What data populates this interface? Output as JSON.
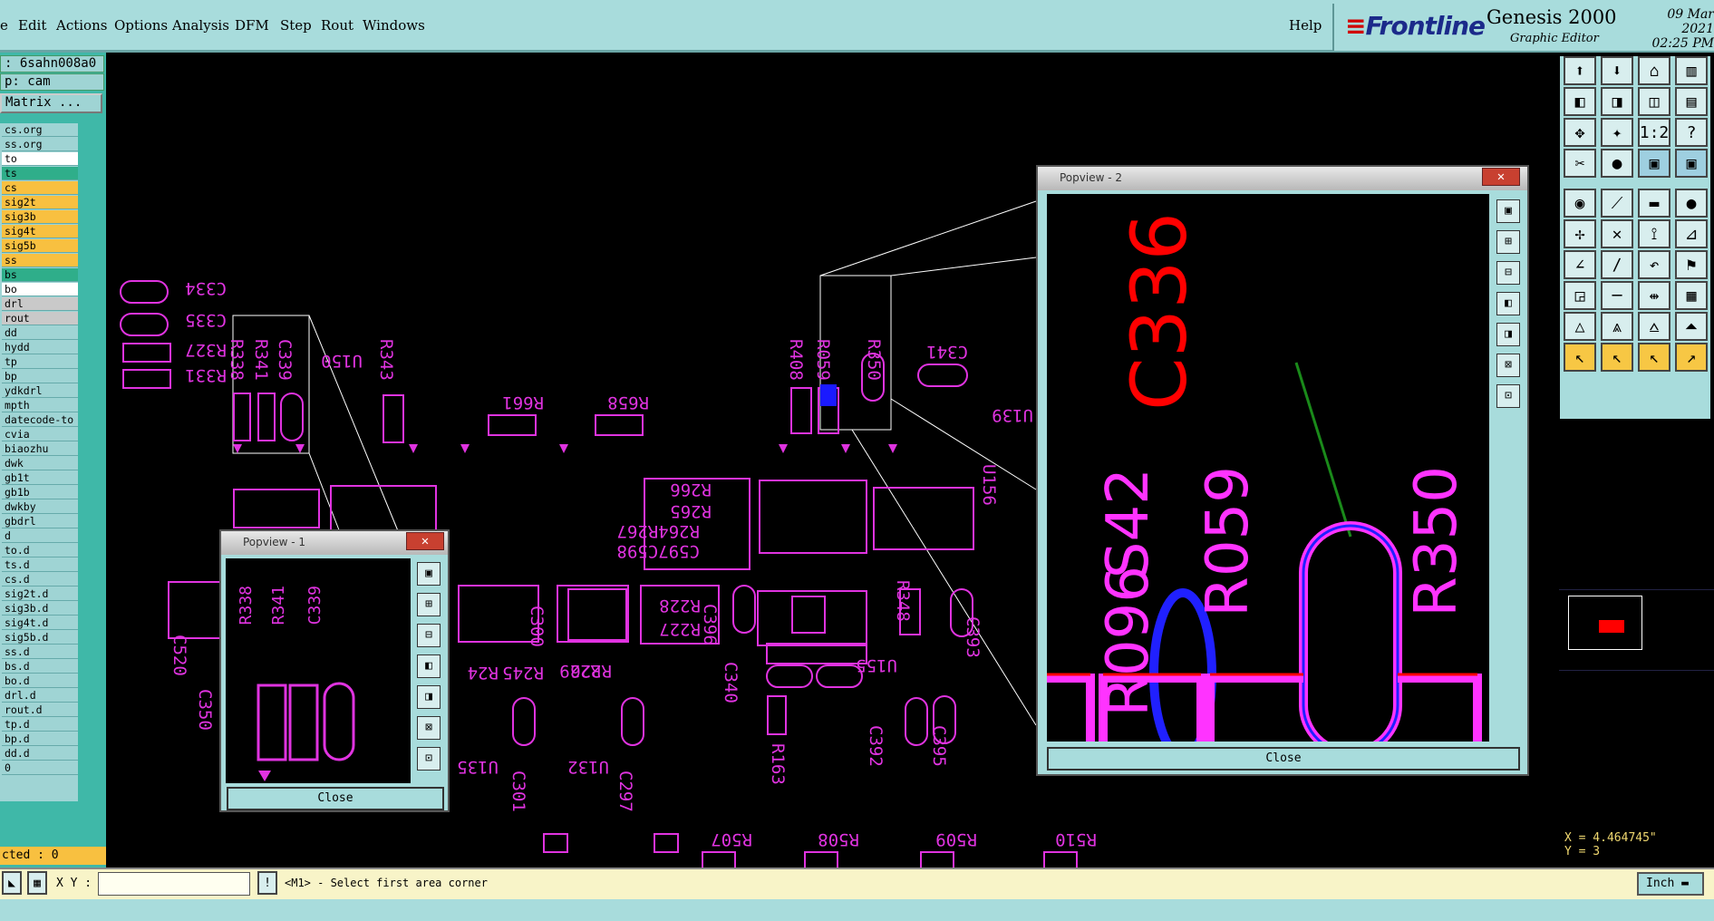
{
  "menu": {
    "items": [
      "e",
      "Edit",
      "Actions",
      "Options",
      "Analysis",
      "DFM",
      "Step",
      "Rout",
      "Windows"
    ],
    "help": "Help"
  },
  "brand": {
    "logo": "Frontline",
    "app": "Genesis 2000",
    "subtitle": "Graphic Editor",
    "date": "09 Mar 2021",
    "time": "02:25 PM"
  },
  "left": {
    "job": ": 6sahn008a0",
    "step": "p: cam",
    "matrix": "Matrix ...",
    "layers": [
      {
        "name": "cs.org",
        "bg": "#9fd4d4"
      },
      {
        "name": "ss.org",
        "bg": "#9fd4d4"
      },
      {
        "name": "to",
        "bg": "#ffffff"
      },
      {
        "name": "ts",
        "bg": "#2fae8a"
      },
      {
        "name": "cs",
        "bg": "#f8c040"
      },
      {
        "name": "sig2t",
        "bg": "#f8c040"
      },
      {
        "name": "sig3b",
        "bg": "#f8c040"
      },
      {
        "name": "sig4t",
        "bg": "#f8c040"
      },
      {
        "name": "sig5b",
        "bg": "#f8c040"
      },
      {
        "name": "ss",
        "bg": "#f8c040"
      },
      {
        "name": "bs",
        "bg": "#2fae8a"
      },
      {
        "name": "bo",
        "bg": "#ffffff"
      },
      {
        "name": "drl",
        "bg": "#c9c9c9"
      },
      {
        "name": "rout",
        "bg": "#c9c9c9"
      },
      {
        "name": "dd",
        "bg": "#9fd4d4"
      },
      {
        "name": "hydd",
        "bg": "#9fd4d4"
      },
      {
        "name": "tp",
        "bg": "#9fd4d4"
      },
      {
        "name": "bp",
        "bg": "#9fd4d4"
      },
      {
        "name": "ydkdrl",
        "bg": "#9fd4d4"
      },
      {
        "name": "mpth",
        "bg": "#9fd4d4"
      },
      {
        "name": "datecode-to",
        "bg": "#9fd4d4"
      },
      {
        "name": "cvia",
        "bg": "#9fd4d4"
      },
      {
        "name": "biaozhu",
        "bg": "#9fd4d4"
      },
      {
        "name": "dwk",
        "bg": "#9fd4d4"
      },
      {
        "name": "gb1t",
        "bg": "#9fd4d4"
      },
      {
        "name": "gb1b",
        "bg": "#9fd4d4"
      },
      {
        "name": "dwkby",
        "bg": "#9fd4d4"
      },
      {
        "name": "gbdrl",
        "bg": "#9fd4d4"
      },
      {
        "name": "d",
        "bg": "#9fd4d4"
      },
      {
        "name": "to.d",
        "bg": "#9fd4d4"
      },
      {
        "name": "ts.d",
        "bg": "#9fd4d4"
      },
      {
        "name": "cs.d",
        "bg": "#9fd4d4"
      },
      {
        "name": "sig2t.d",
        "bg": "#9fd4d4"
      },
      {
        "name": "sig3b.d",
        "bg": "#9fd4d4"
      },
      {
        "name": "sig4t.d",
        "bg": "#9fd4d4"
      },
      {
        "name": "sig5b.d",
        "bg": "#9fd4d4"
      },
      {
        "name": "ss.d",
        "bg": "#9fd4d4"
      },
      {
        "name": "bs.d",
        "bg": "#9fd4d4"
      },
      {
        "name": "bo.d",
        "bg": "#9fd4d4"
      },
      {
        "name": "drl.d",
        "bg": "#9fd4d4"
      },
      {
        "name": "rout.d",
        "bg": "#9fd4d4"
      },
      {
        "name": "tp.d",
        "bg": "#9fd4d4"
      },
      {
        "name": "bp.d",
        "bg": "#9fd4d4"
      },
      {
        "name": "dd.d",
        "bg": "#9fd4d4"
      },
      {
        "name": "0",
        "bg": "#9fd4d4"
      }
    ],
    "selected": "cted : 0"
  },
  "popup1": {
    "title": "Popview - 1",
    "close": "Close",
    "labels": [
      "R338",
      "R341",
      "C339"
    ]
  },
  "popup2": {
    "title": "Popview - 2",
    "close": "Close",
    "labels": [
      "C336",
      "S42",
      "R096",
      "R059",
      "R350"
    ]
  },
  "canvas_labels": [
    "C334",
    "C335",
    "R327",
    "R331",
    "R338",
    "R341",
    "C339",
    "U150",
    "R343",
    "R661",
    "R658",
    "R408",
    "R059",
    "R350",
    "C341",
    "U139",
    "R266",
    "R265",
    "R264R267",
    "C597C598",
    "R228",
    "R227",
    "R229",
    "R226",
    "C300",
    "C396",
    "C393",
    "U156",
    "U155",
    "R245",
    "R24",
    "U135",
    "U132",
    "C301",
    "C297",
    "R507",
    "R508",
    "R509",
    "R510",
    "C340",
    "R163",
    "R348",
    "C392",
    "C395",
    "C350",
    "C520"
  ],
  "coords": {
    "x": "X = 4.464745\"",
    "y": "Y = 3"
  },
  "status": {
    "xy_label": "X Y :",
    "xy_value": "",
    "message": "<M1> - Select first area corner",
    "units": "Inch"
  },
  "colors": {
    "panel": "#a8dcdc",
    "silk": "#e033e0",
    "accent_red": "#ff0000",
    "accent_blue": "#1a1aff"
  }
}
